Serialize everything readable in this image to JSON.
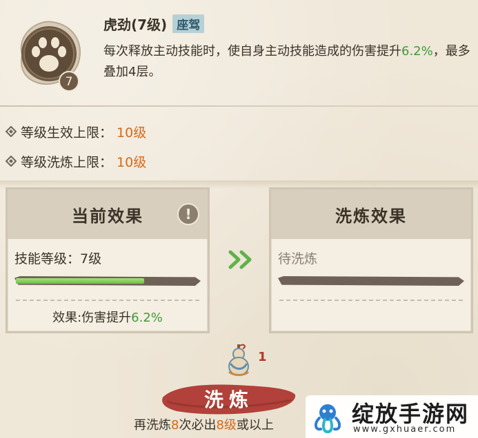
{
  "skill": {
    "name": "虎劲(7级)",
    "tag": "座驾",
    "level_badge": "7",
    "icon": "paw-icon",
    "desc_part1": "每次释放主动技能时，使自身主动技能造成的伤害提升",
    "desc_highlight": "6.2%",
    "desc_part2": "，最多叠加4层。"
  },
  "limits": [
    {
      "label": "等级生效上限：",
      "value": "10级"
    },
    {
      "label": "等级洗炼上限：",
      "value": "10级"
    }
  ],
  "current_panel": {
    "title": "当前效果",
    "info_icon": "!",
    "level_text": "技能等级：7级",
    "progress": 0.7,
    "effect_label": "效果:伤害提升",
    "effect_value": "6.2%"
  },
  "refine_panel": {
    "title": "洗炼效果",
    "pending_text": "待洗炼",
    "progress": 0
  },
  "cost": {
    "icon": "gourd-icon",
    "count": "1"
  },
  "refine_button": {
    "label": "洗炼"
  },
  "guarantee": {
    "part1": "再洗炼",
    "n": "8",
    "part2": "次必出",
    "lvl": "8级",
    "part3": "或以上"
  },
  "watermark": {
    "title": "绽放手游网",
    "url": "www.gxhuaer.com"
  },
  "colors": {
    "background": "#efe7d8",
    "orange": "#d36a1a",
    "green": "#3f9a3a",
    "refine_red": "#b1413a",
    "tag_blue": "#b7d0d6"
  }
}
